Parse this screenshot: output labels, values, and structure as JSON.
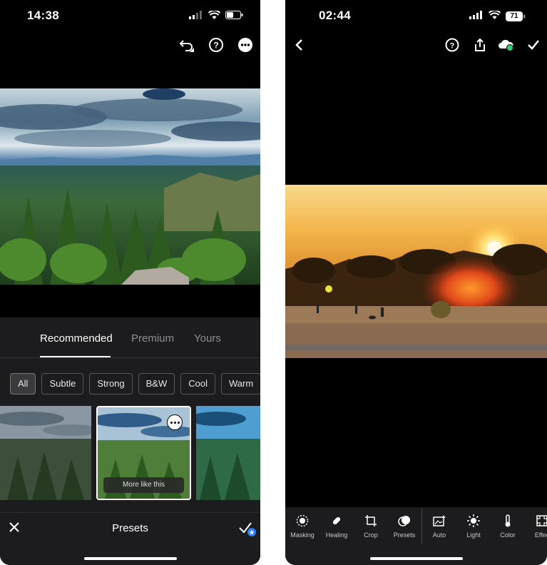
{
  "left_screen": {
    "status": {
      "time": "14:38"
    },
    "tabs": [
      {
        "label": "Recommended",
        "active": true
      },
      {
        "label": "Premium",
        "active": false
      },
      {
        "label": "Yours",
        "active": false
      }
    ],
    "filters": [
      {
        "label": "All",
        "active": true
      },
      {
        "label": "Subtle",
        "active": false
      },
      {
        "label": "Strong",
        "active": false
      },
      {
        "label": "B&W",
        "active": false
      },
      {
        "label": "Cool",
        "active": false
      },
      {
        "label": "Warm",
        "active": false
      }
    ],
    "thumb_button": "More like this",
    "bottom_title": "Presets"
  },
  "right_screen": {
    "status": {
      "time": "02:44",
      "battery": "71"
    },
    "tools": [
      {
        "label": "Masking",
        "icon": "masking-icon"
      },
      {
        "label": "Healing",
        "icon": "healing-icon"
      },
      {
        "label": "Crop",
        "icon": "crop-icon"
      },
      {
        "label": "Presets",
        "icon": "presets-icon"
      },
      {
        "label": "Auto",
        "icon": "auto-icon"
      },
      {
        "label": "Light",
        "icon": "light-icon"
      },
      {
        "label": "Color",
        "icon": "color-icon"
      },
      {
        "label": "Effec",
        "icon": "effects-icon"
      }
    ]
  },
  "colors": {
    "panel": "#1c1c1e",
    "accent": "#2d7ff9",
    "cloud_badge": "#2ecc71"
  }
}
